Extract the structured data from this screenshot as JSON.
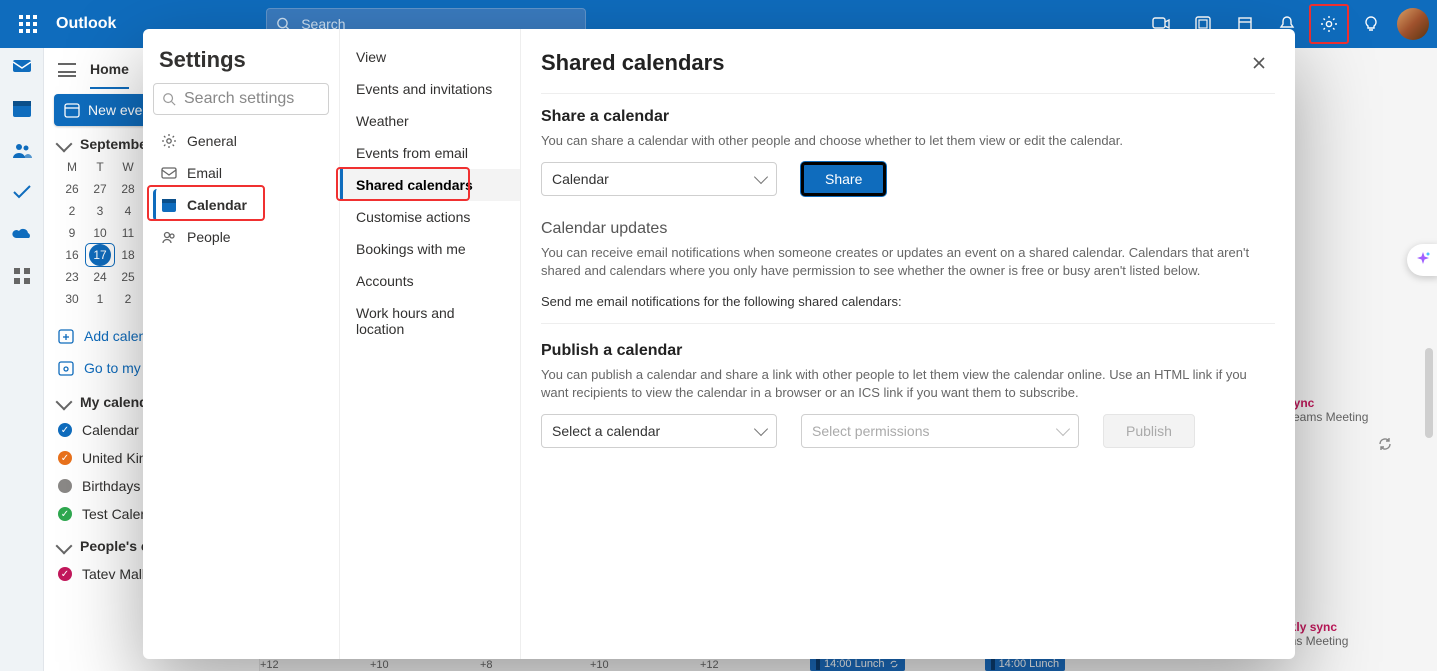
{
  "topbar": {
    "brand": "Outlook",
    "search_placeholder": "Search"
  },
  "nav": {
    "home": "Home",
    "new_event": "New event"
  },
  "miniCal": {
    "month_label": "September",
    "dow": [
      "M",
      "T",
      "W"
    ],
    "weeks": [
      [
        "26",
        "27",
        "28"
      ],
      [
        "2",
        "3",
        "4"
      ],
      [
        "9",
        "10",
        "11"
      ],
      [
        "16",
        "17",
        "18"
      ],
      [
        "23",
        "24",
        "25"
      ],
      [
        "30",
        "1",
        "2"
      ]
    ],
    "today": "17"
  },
  "sideLinks": {
    "add_calendar": "Add calendar",
    "go_booking": "Go to my Booking"
  },
  "sections": {
    "my_calendars": "My calendars",
    "peoples_calendars": "People's calendars"
  },
  "calendars": [
    {
      "name": "Calendar",
      "color": "#0f6cbd",
      "checked": true
    },
    {
      "name": "United Kingdom",
      "color": "#e8711c",
      "checked": true
    },
    {
      "name": "Birthdays",
      "color": "#8a8886",
      "checked": false
    },
    {
      "name": "Test Calendar",
      "color": "#2fa84f",
      "checked": true
    }
  ],
  "people_cals": [
    {
      "name": "Tatev Malk",
      "color": "#c2185b",
      "checked": true
    }
  ],
  "peek": {
    "title": "sync",
    "sub": "Teams Meeting",
    "title2": "weekly sync",
    "sub2": "Teams Meeting"
  },
  "lunch": {
    "plus12": "+12",
    "plus10a": "+10",
    "plus8": "+8",
    "plus10b": "+10",
    "plus12b": "+12",
    "chip": "14:00 Lunch"
  },
  "settings": {
    "title": "Settings",
    "search_placeholder": "Search settings",
    "cats": {
      "general": "General",
      "email": "Email",
      "calendar": "Calendar",
      "people": "People"
    },
    "sub": {
      "view": "View",
      "events_invitations": "Events and invitations",
      "weather": "Weather",
      "events_from_email": "Events from email",
      "shared_calendars": "Shared calendars",
      "customise_actions": "Customise actions",
      "bookings_with_me": "Bookings with me",
      "accounts": "Accounts",
      "work_hours": "Work hours and location"
    },
    "panel": {
      "heading": "Shared calendars",
      "share_title": "Share a calendar",
      "share_desc": "You can share a calendar with other people and choose whether to let them view or edit the calendar.",
      "share_select": "Calendar",
      "share_btn": "Share",
      "updates_title": "Calendar updates",
      "updates_desc": "You can receive email notifications when someone creates or updates an event on a shared calendar. Calendars that aren't shared and calendars where you only have permission to see whether the owner is free or busy aren't listed below.",
      "updates_prompt": "Send me email notifications for the following shared calendars:",
      "publish_title": "Publish a calendar",
      "publish_desc": "You can publish a calendar and share a link with other people to let them view the calendar online. Use an HTML link if you want recipients to view the calendar in a browser or an ICS link if you want them to subscribe.",
      "publish_select": "Select a calendar",
      "publish_perm": "Select permissions",
      "publish_btn": "Publish"
    }
  }
}
